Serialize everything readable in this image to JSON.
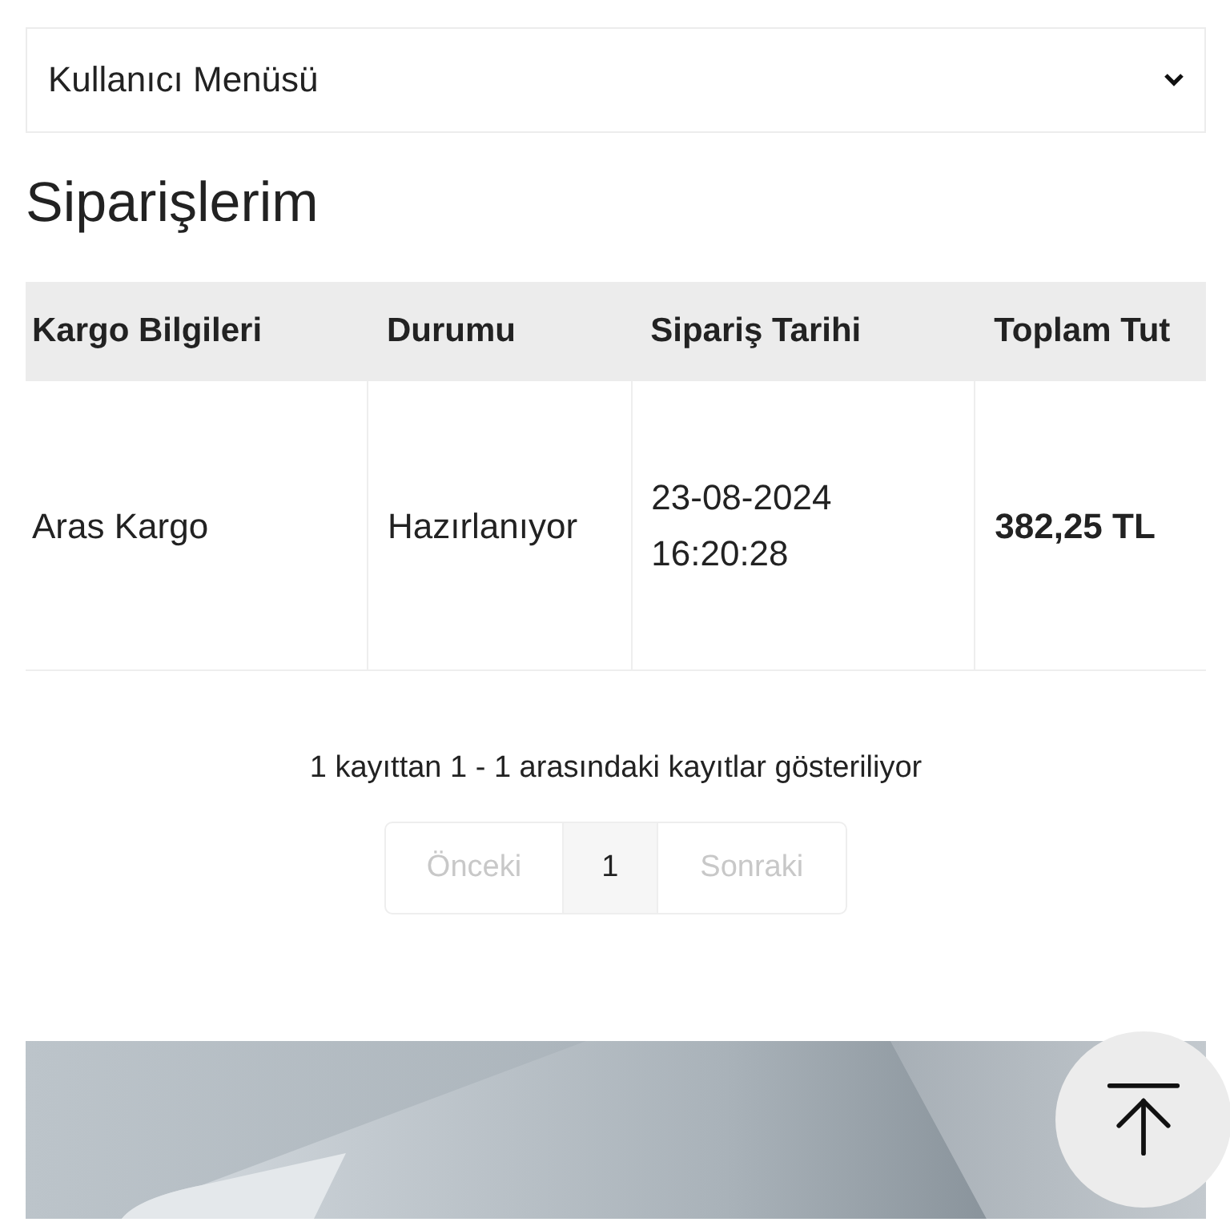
{
  "user_menu": {
    "label": "Kullanıcı Menüsü",
    "expanded": false
  },
  "title": "Siparişlerim",
  "table": {
    "columns": [
      "Kargo Bilgileri",
      "Durumu",
      "Sipariş Tarihi",
      "Toplam Tut"
    ],
    "rows": [
      {
        "cells": [
          "Aras Kargo",
          "Hazırlanıyor",
          "23-08-2024 16:20:28",
          "382,25 TL"
        ]
      }
    ]
  },
  "summary": "1 kayıttan 1 - 1 arasındaki kayıtlar gösteriliyor",
  "pagination": {
    "previous": {
      "label": "Önceki",
      "disabled": true
    },
    "pages": [
      {
        "label": "1",
        "selected": true
      }
    ],
    "next": {
      "label": "Sonraki",
      "disabled": true
    }
  }
}
